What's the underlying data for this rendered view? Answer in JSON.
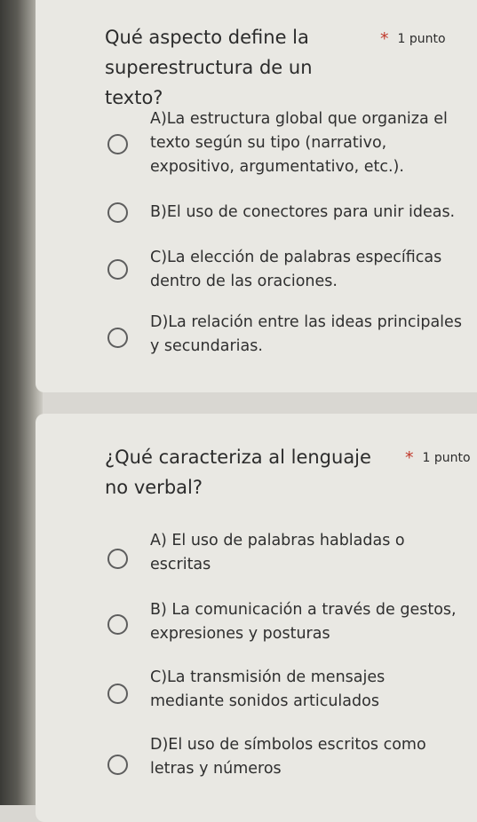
{
  "questions": [
    {
      "title": "Qué aspecto define la superestructura de un texto?",
      "required_mark": "*",
      "points": "1 punto",
      "options": [
        "A)La estructura global que organiza el texto según su tipo (narrativo, expositivo, argumentativo, etc.).",
        "B)El uso de conectores para unir ideas.",
        "C)La elección de palabras específicas dentro de las oraciones.",
        "D)La relación entre las ideas principales y secundarias."
      ]
    },
    {
      "title": "¿Qué caracteriza al lenguaje no verbal?",
      "required_mark": "*",
      "points": "1 punto",
      "options": [
        "A) El uso de palabras habladas o escritas",
        "B) La comunicación a través de gestos, expresiones y posturas",
        "C)La transmisión de mensajes mediante sonidos articulados",
        "D)El uso de símbolos escritos como letras y números"
      ]
    }
  ]
}
